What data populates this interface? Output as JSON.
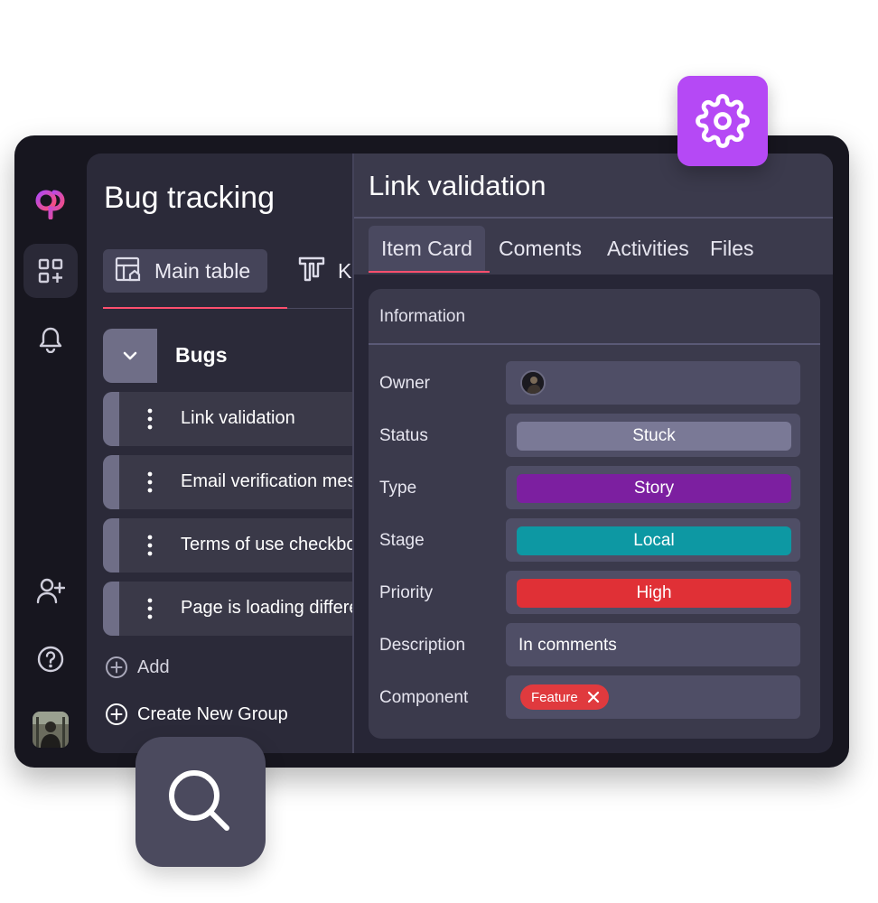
{
  "board": {
    "title": "Bug tracking",
    "views": [
      {
        "label": "Main table",
        "icon": "table-home-icon"
      },
      {
        "label": "K",
        "icon": "kanban-icon"
      }
    ],
    "group": {
      "name": "Bugs"
    },
    "items": [
      {
        "label": "Link validation"
      },
      {
        "label": "Email verification mes"
      },
      {
        "label": "Terms of use checkbo"
      },
      {
        "label": "Page is loading differe"
      }
    ],
    "add_label": "Add",
    "create_group_label": "Create New Group"
  },
  "detail": {
    "title": "Link validation",
    "tabs": [
      {
        "label": "Item Card"
      },
      {
        "label": "Coments"
      },
      {
        "label": "Activities"
      },
      {
        "label": "Files"
      }
    ],
    "info_title": "Information",
    "fields": {
      "owner": {
        "label": "Owner"
      },
      "status": {
        "label": "Status",
        "value": "Stuck",
        "color": "#7a7996"
      },
      "type": {
        "label": "Type",
        "value": "Story",
        "color": "#7c1fa0"
      },
      "stage": {
        "label": "Stage",
        "value": "Local",
        "color": "#0d98a3"
      },
      "priority": {
        "label": "Priority",
        "value": "High",
        "color": "#e03036"
      },
      "description": {
        "label": "Description",
        "value": "In comments"
      },
      "component": {
        "label": "Component",
        "tag": "Feature",
        "tag_color": "#e03a3e"
      }
    }
  },
  "colors": {
    "accent": "#ff4f6e",
    "brand_tile": "#b549f5",
    "background": "#17161f"
  },
  "icons": {
    "rail": [
      "logo-icon",
      "apps-icon",
      "bell-icon",
      "add-user-icon",
      "help-icon",
      "avatar"
    ],
    "floating": [
      "gear-icon",
      "search-icon"
    ]
  }
}
